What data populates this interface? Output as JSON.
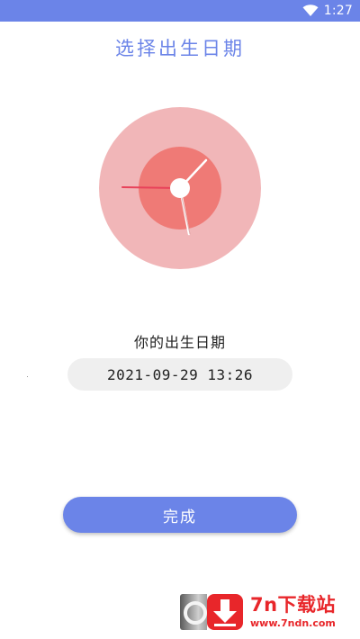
{
  "status_bar": {
    "time": "1:27",
    "wifi_icon": "wifi-icon",
    "background_color": "#6b84e8"
  },
  "header": {
    "title": "选择出生日期"
  },
  "clock": {
    "icon": "clock-illustration",
    "outer_color": "#f1b6b8",
    "inner_color": "#ef7a76"
  },
  "birth_date": {
    "label": "你的出生日期",
    "value": "2021-09-29 13:26"
  },
  "actions": {
    "done_label": "完成",
    "accent_color": "#6b84e8"
  },
  "watermark": {
    "name": "7n下载站",
    "url": "www.7ndn.com",
    "icon": "download-arrow-icon",
    "color": "#e8262a"
  }
}
